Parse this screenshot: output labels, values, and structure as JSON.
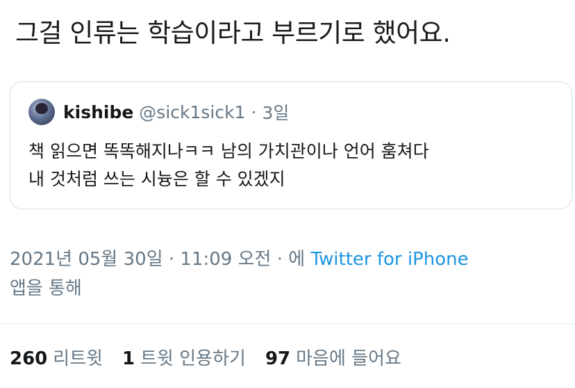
{
  "tweet": {
    "text": "그걸 인류는 학습이라고 부르기로 했어요."
  },
  "quote": {
    "display_name": "kishibe",
    "handle": "@sick1sick1",
    "separator": "·",
    "date": "3일",
    "lines": [
      "책 읽으면 똑똑해지나ㅋㅋ 남의 가치관이나 언어 훔쳐다",
      "내 것처럼 쓰는 시늉은 할 수 있겠지"
    ]
  },
  "meta": {
    "timestamp": "2021년 05월 30일 · 11:09 오전 · 에",
    "source": "Twitter for iPhone",
    "suffix": "앱을 통해"
  },
  "stats": {
    "retweets_count": "260",
    "retweets_label": "리트윗",
    "quotes_count": "1",
    "quotes_label": "트윗 인용하기",
    "likes_count": "97",
    "likes_label": "마음에 들어요"
  },
  "colors": {
    "text": "#14171a",
    "secondary": "#657786",
    "link": "#1b95e0",
    "border": "#d8dde2"
  }
}
